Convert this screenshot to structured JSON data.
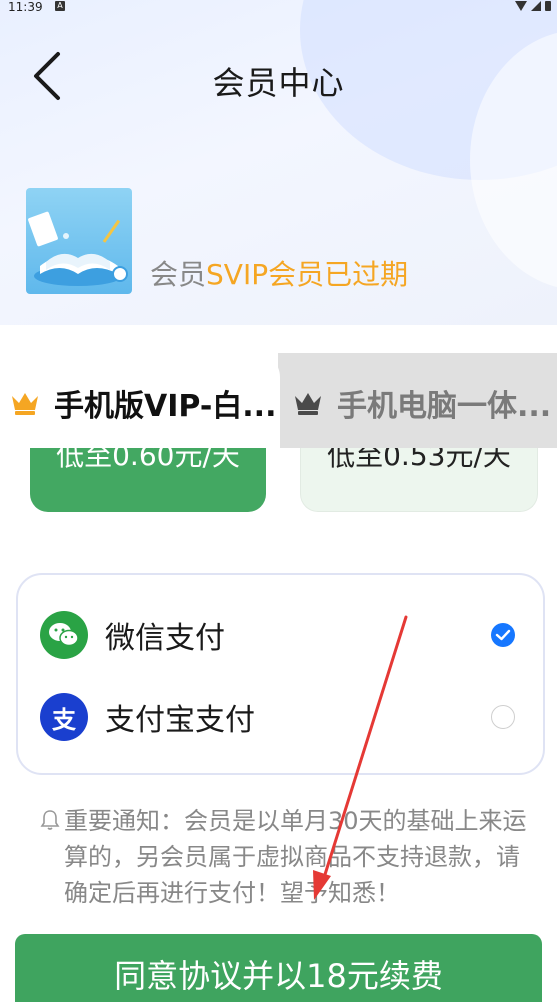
{
  "status_bar": {
    "time": "11:39",
    "notif_glyph": "A"
  },
  "header": {
    "title": "会员中心",
    "back_icon": "chevron-left-icon"
  },
  "member": {
    "status_prefix": "会员",
    "status_highlight": "SVIP会员已过期"
  },
  "tabs": [
    {
      "label": "手机版VIP-白...",
      "active": true,
      "icon": "crown-icon"
    },
    {
      "label": "手机电脑一体...",
      "active": false,
      "icon": "crown-icon"
    }
  ],
  "plans": [
    {
      "price_text": "低至0.60元/天",
      "selected": true
    },
    {
      "price_text": "低至0.53元/天",
      "selected": false
    }
  ],
  "payment": {
    "methods": [
      {
        "label": "微信支付",
        "icon": "wechat-icon",
        "selected": true
      },
      {
        "label": "支付宝支付",
        "icon": "alipay-icon",
        "icon_glyph": "支",
        "selected": false
      }
    ]
  },
  "notice": {
    "text": "重要通知：会员是以单月30天的基础上来运算的，另会员属于虚拟商品不支持退款，请确定后再进行支付！望予知悉！"
  },
  "cta": {
    "label": "同意协议并以18元续费"
  },
  "colors": {
    "accent_green": "#43a862",
    "highlight_orange": "#f5a623",
    "radio_blue": "#1677ff",
    "alipay_blue": "#1a3fcf",
    "annotation_red": "#e53935"
  }
}
